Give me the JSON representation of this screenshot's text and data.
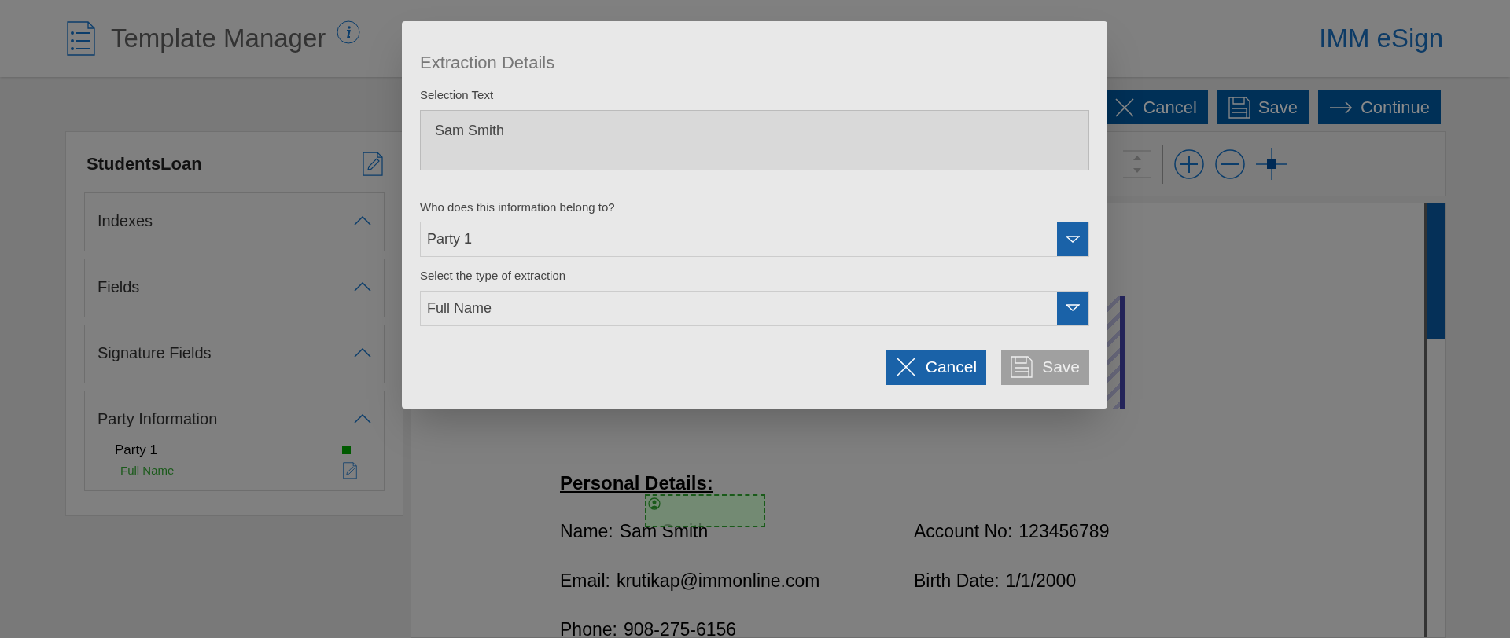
{
  "header": {
    "title": "Template Manager",
    "brand": "IMM eSign"
  },
  "actions": [
    {
      "label": "Cancel",
      "kind": "cancel"
    },
    {
      "label": "Save",
      "kind": "save"
    },
    {
      "label": "Continue",
      "kind": "continue"
    }
  ],
  "sidebar": {
    "title": "StudentsLoan",
    "sections": [
      {
        "label": "Indexes",
        "expanded": true
      },
      {
        "label": "Fields",
        "expanded": true
      },
      {
        "label": "Signature Fields",
        "expanded": true
      },
      {
        "label": "Party Information",
        "expanded": true,
        "parties": [
          {
            "name": "Party 1",
            "color": "#005a00",
            "fields": [
              "Full Name"
            ]
          }
        ]
      }
    ]
  },
  "document": {
    "heading": "Personal Details:",
    "rows": [
      [
        {
          "label": "Name:",
          "value": "Sam Smith",
          "marked": true
        },
        {
          "label": "Account No:",
          "value": "123456789",
          "marked": false
        }
      ],
      [
        {
          "label": "Email:",
          "value": "krutikap@immonline.com",
          "marked": false
        },
        {
          "label": "Birth Date:",
          "value": "1/1/2000",
          "marked": false
        }
      ],
      [
        {
          "label": "Phone:",
          "value": "908-275-6156",
          "marked": false
        }
      ]
    ]
  },
  "modal": {
    "title": "Extraction Details",
    "selection_label": "Selection Text",
    "selection_value": "Sam Smith",
    "owner_label": "Who does this information belong to?",
    "owner_value": "Party 1",
    "type_label": "Select the type of extraction",
    "type_value": "Full Name",
    "buttons": [
      {
        "label": "Cancel",
        "kind": "cancel",
        "disabled": false
      },
      {
        "label": "Save",
        "kind": "save",
        "disabled": true
      }
    ]
  }
}
